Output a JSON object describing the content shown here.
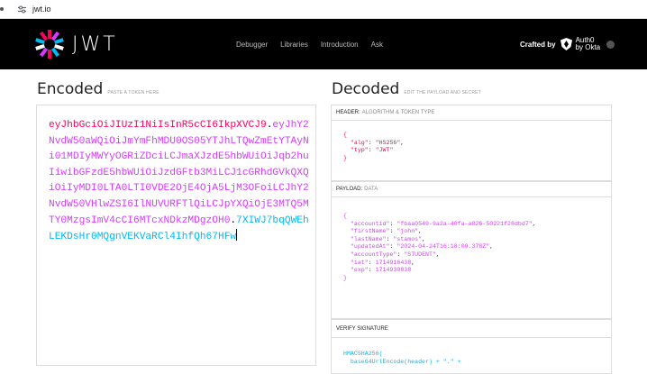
{
  "browser": {
    "url": "jwt.io"
  },
  "nav": {
    "logo_text": "JWT",
    "links": [
      "Debugger",
      "Libraries",
      "Introduction",
      "Ask"
    ],
    "crafted_by": "Crafted by",
    "auth0_line1": "Auth0",
    "auth0_line2": "by Okta"
  },
  "encoded": {
    "title": "Encoded",
    "subtitle": "PASTE A TOKEN HERE",
    "header_part": "eyJhbGciOiJIUzI1NiIsInR5cCI6IkpXVCJ9",
    "payload_part": "eyJhY2NvdW50aWQiOiJmYmFhMDU0OS05YTJhLTQwZmEtYTAyNi01MDIyMWYyOGRiZDciLCJmaXJzdE5hbWUiOiJqb2huIiwibGFzdE5hbWUiOiJzdGFtb3MiLCJ1cGRhdGVkQXQiOiIyMDI0LTA0LTI0VDE2OjE4OjA5LjM3OFoiLCJhY2NvdW50VHlwZSI6IlNUVURFTlQiLCJpYXQiOjE3MTQ5MTY0MzgsImV4cCI6MTcxNDkzMDgzOH0",
    "signature_part": "7XIWJ7bqQWEhLEKDsHr0MQgnVEKVaRCl4IhfQh67HFw"
  },
  "decoded": {
    "title": "Decoded",
    "subtitle": "EDIT THE PAYLOAD AND SECRET",
    "header_label": "HEADER:",
    "header_sub": "ALGORITHM & TOKEN TYPE",
    "payload_label": "PAYLOAD:",
    "payload_sub": "DATA",
    "verify_label": "VERIFY SIGNATURE",
    "header_json": {
      "alg": "\"HS256\"",
      "typ": "\"JWT\""
    },
    "payload_json": {
      "accountid": "\"fbaa0549-9a2a-40fa-a026-50221f28dbd7\"",
      "firstName": "\"john\"",
      "lastName": "\"stamos\"",
      "updatedAt": "\"2024-04-24T16:18:09.378Z\"",
      "accountType": "\"STUDENT\"",
      "iat": "1714916438",
      "exp": "1714930838"
    },
    "verify_line1": "HMACSHA256(",
    "verify_line2": "  base64UrlEncode(header) + \".\" +"
  },
  "colors": {
    "header": "#fb015b",
    "payload": "#d63aff",
    "signature": "#00b9f1",
    "nav_bg": "#000000"
  }
}
